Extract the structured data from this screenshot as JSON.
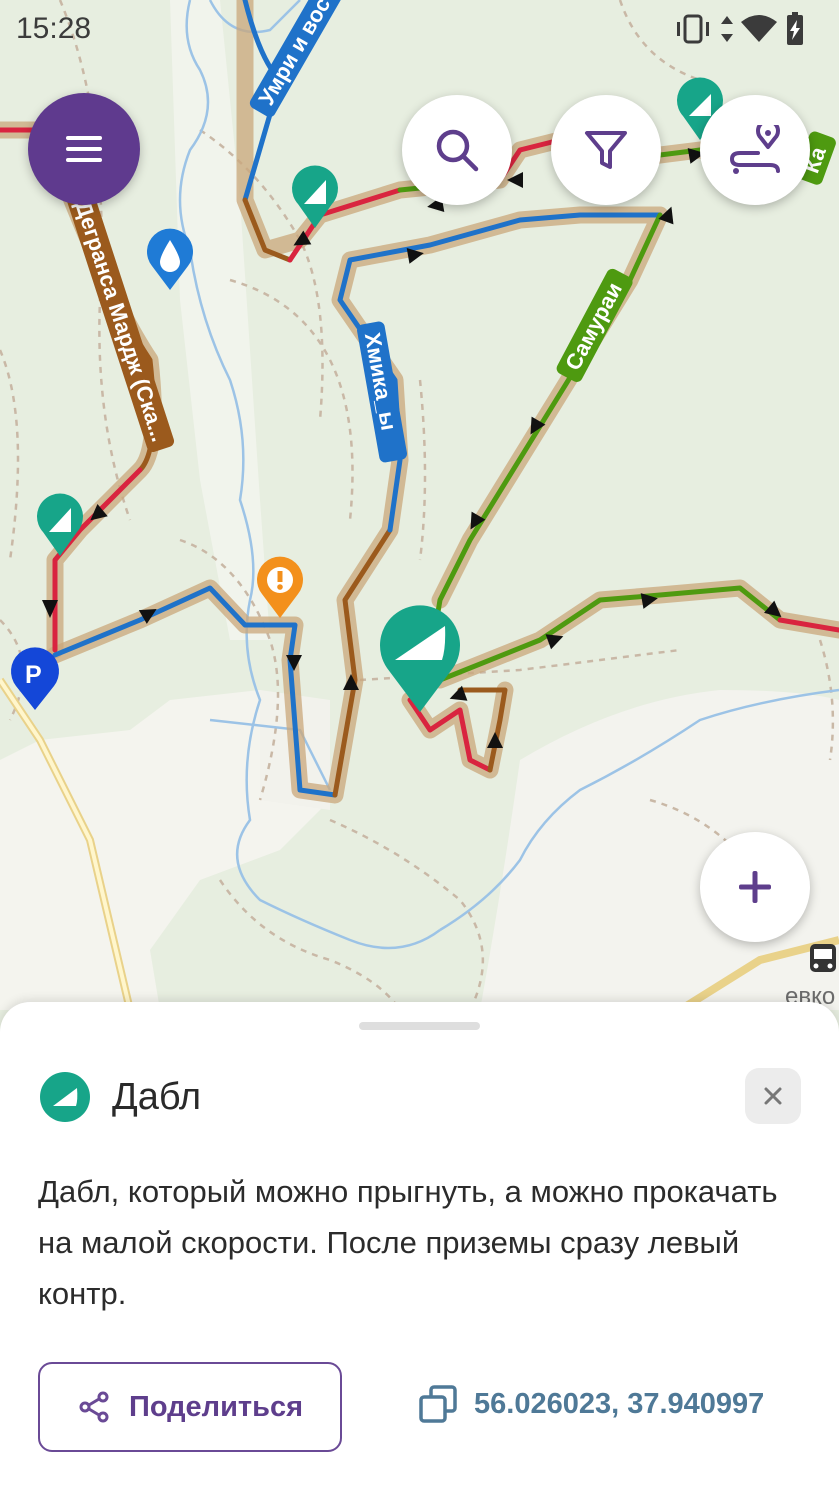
{
  "status_bar": {
    "time": "15:28"
  },
  "map": {
    "trail_labels": [
      "Умри и вос",
      "Хмика_ы",
      "Самураи",
      "Дегранса Мардж (Ска...",
      "Ка"
    ],
    "street_label": "евко",
    "parking_label": "P"
  },
  "colors": {
    "accent": "#5f3a8e",
    "poi_green": "#17a589",
    "trail_blue": "#1f72c9",
    "trail_red": "#d9243f",
    "trail_green": "#4e9a10",
    "trail_brown": "#9b5a1d"
  },
  "controls": {
    "menu_icon": "menu-icon",
    "search_icon": "search-icon",
    "filter_icon": "filter-icon",
    "route_icon": "route-icon",
    "add_icon": "plus-icon"
  },
  "poi_sheet": {
    "title": "Дабл",
    "description": "Дабл, который можно прыгнуть, а можно прокачать на малой скорости. После приземы сразу левый контр.",
    "share_label": "Поделиться",
    "coordinates": "56.026023, 37.940997",
    "close_icon": "close-icon"
  }
}
